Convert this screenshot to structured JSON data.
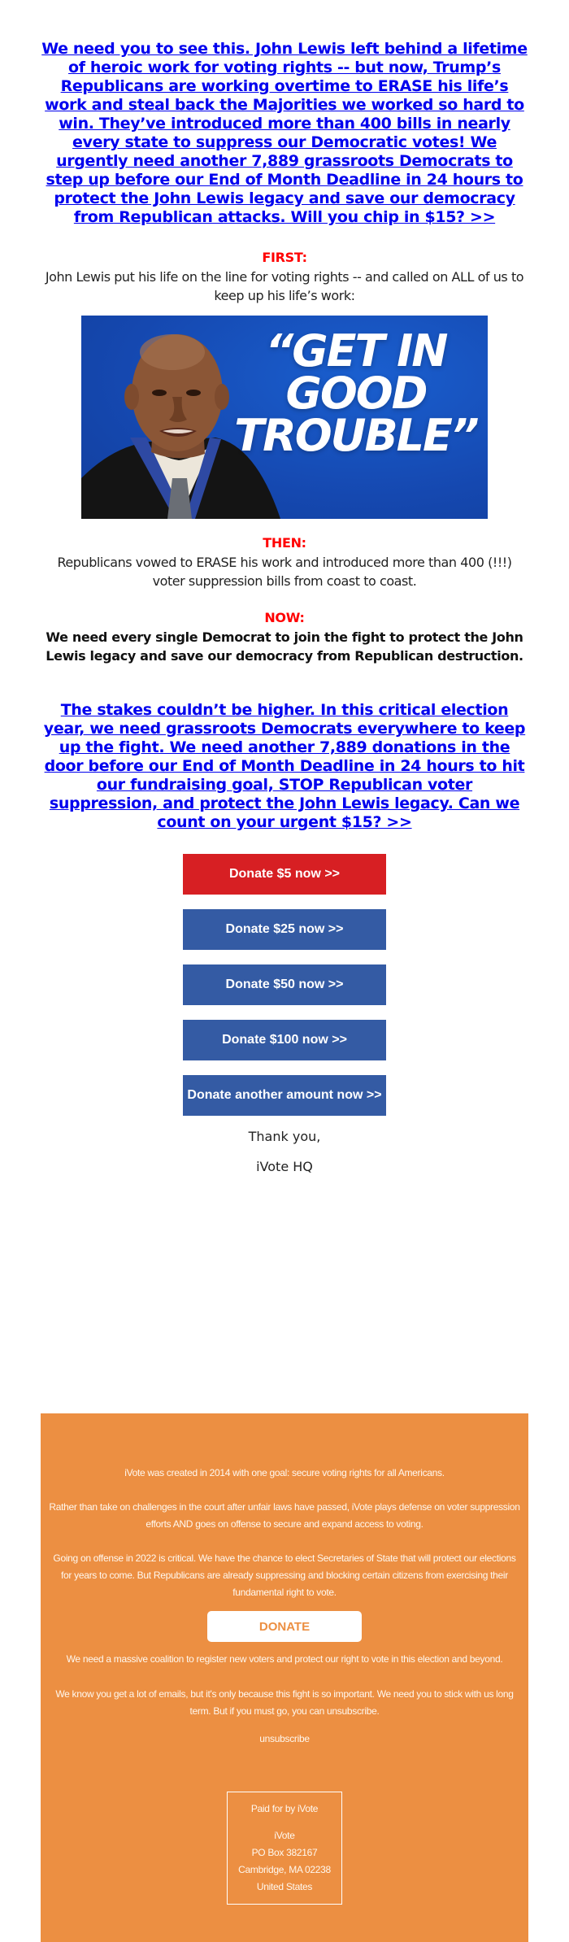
{
  "headline_link": "We need you to see this. John Lewis left behind a lifetime of heroic work for voting rights -- but now, Trump’s Republicans are working overtime to ERASE his life’s work and steal back the Majorities we worked so hard to win. They’ve introduced more than 400 bills in nearly every state to suppress our Democratic votes! We urgently need another 7,889 grassroots Democrats to step up before our End of Month Deadline in 24 hours to protect the John Lewis legacy and save our democracy from Republican attacks. Will you chip in $15? >>",
  "first": {
    "label": "FIRST:",
    "text": "John Lewis put his life on the line for voting rights -- and called on ALL of us to keep up his life’s work:"
  },
  "hero_image": {
    "alt": "John Lewis portrait with quote",
    "quote_lines": [
      "“GET IN",
      "GOOD",
      "TROUBLE”"
    ],
    "background_color": "#1548b0"
  },
  "then": {
    "label": "THEN:",
    "text": "Republicans vowed to ERASE his work and introduced more than 400 (!!!) voter suppression bills from coast to coast."
  },
  "now": {
    "label": "NOW:",
    "text": "We need every single Democrat to join the fight to protect the John Lewis legacy and save our democracy from Republican destruction."
  },
  "stakes_link": "The stakes couldn’t be higher. In this critical election year, we need grassroots Democrats everywhere to keep up the fight. We need another 7,889 donations in the door before our End of Month Deadline in 24 hours to hit our fundraising goal, STOP Republican voter suppression, and protect the John Lewis legacy. Can we count on your urgent $15? >>",
  "donate_buttons": [
    {
      "label": "Donate $5 now >>",
      "color": "#d71f23"
    },
    {
      "label": "Donate $25 now >>",
      "color": "#345ba4"
    },
    {
      "label": "Donate $50 now >>",
      "color": "#345ba4"
    },
    {
      "label": "Donate $100 now >>",
      "color": "#345ba4"
    },
    {
      "label": "Donate another amount now >>",
      "color": "#345ba4"
    }
  ],
  "signoff": {
    "thanks": "Thank you,",
    "sender": "iVote HQ"
  },
  "footer": {
    "background_color": "#ec8f42",
    "para1": "iVote was created in 2014 with one goal: secure voting rights for all Americans.",
    "para2": "Rather than take on challenges in the court after unfair laws have passed, iVote plays defense on voter suppression efforts AND goes on offense to secure and expand access to voting.",
    "para3": "Going on offense in 2022 is critical. We have the chance to elect Secretaries of State that will protect our elections for years to come. But Republicans are already suppressing and blocking certain citizens from exercising their fundamental right to vote.",
    "donate_label": "DONATE",
    "para4": "We need a massive coalition to register new voters and protect our right to vote in this election and beyond.",
    "para5": "We know you get a lot of emails, but it's only because this fight is so important. We need you to stick with us long term. But if you must go, you can unsubscribe.",
    "unsubscribe_label": "unsubscribe",
    "paid_for": "Paid for by iVote",
    "address": {
      "name": "iVote",
      "po_box": "PO Box 382167",
      "city": "Cambridge, MA 02238",
      "country": "United States"
    }
  }
}
